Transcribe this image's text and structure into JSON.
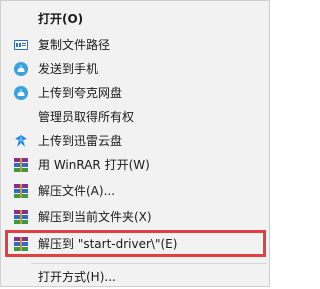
{
  "menu": {
    "items": [
      {
        "label": "打开(O)",
        "icon": "none",
        "bold": true
      },
      {
        "label": "复制文件路径",
        "icon": "file-path-icon"
      },
      {
        "label": "发送到手机",
        "icon": "cloud-phone-icon"
      },
      {
        "label": "上传到夸克网盘",
        "icon": "cloud-upload-icon"
      },
      {
        "label": "管理员取得所有权",
        "icon": "none"
      },
      {
        "label": "上传到迅雷云盘",
        "icon": "thunder-bird-icon"
      },
      {
        "label": "用 WinRAR 打开(W)",
        "icon": "winrar-icon"
      },
      {
        "label": "解压文件(A)...",
        "icon": "winrar-icon"
      },
      {
        "label": "解压到当前文件夹(X)",
        "icon": "winrar-icon"
      },
      {
        "label": "解压到 \"start-driver\\\"(E)",
        "icon": "winrar-icon",
        "highlighted": true
      },
      {
        "label": "打开方式(H)...",
        "icon": "none"
      }
    ]
  },
  "colors": {
    "menu_bg": "#f2f2f2",
    "highlight_border": "#e23f3f",
    "text": "#1a1a1a"
  }
}
